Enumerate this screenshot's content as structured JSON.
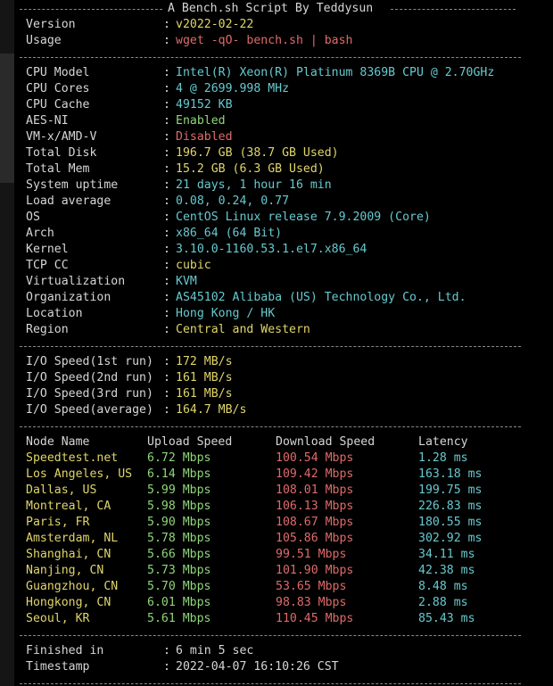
{
  "title": "A Bench.sh Script By Teddysun",
  "header": [
    {
      "label": "Version",
      "value": "v2022-02-22",
      "color": "#e0d56a"
    },
    {
      "label": "Usage",
      "value": "wget -qO- bench.sh | bash",
      "color": "#e06a6a"
    }
  ],
  "system": [
    {
      "label": "CPU Model",
      "value": "Intel(R) Xeon(R) Platinum 8369B CPU @ 2.70GHz",
      "color": "#66c9cf"
    },
    {
      "label": "CPU Cores",
      "value": "4 @ 2699.998 MHz",
      "color": "#66c9cf"
    },
    {
      "label": "CPU Cache",
      "value": "49152 KB",
      "color": "#66c9cf"
    },
    {
      "label": "AES-NI",
      "value": "Enabled",
      "color": "#8fd67a"
    },
    {
      "label": "VM-x/AMD-V",
      "value": "Disabled",
      "color": "#e06a6a"
    },
    {
      "label": "Total Disk",
      "value": "196.7 GB (38.7 GB Used)",
      "color": "#e0d56a"
    },
    {
      "label": "Total Mem",
      "value": "15.2 GB (6.3 GB Used)",
      "color": "#e0d56a"
    },
    {
      "label": "System uptime",
      "value": "21 days, 1 hour 16 min",
      "color": "#66c9cf"
    },
    {
      "label": "Load average",
      "value": "0.08, 0.24, 0.77",
      "color": "#66c9cf"
    },
    {
      "label": "OS",
      "value": "CentOS Linux release 7.9.2009 (Core)",
      "color": "#66c9cf"
    },
    {
      "label": "Arch",
      "value": "x86_64 (64 Bit)",
      "color": "#66c9cf"
    },
    {
      "label": "Kernel",
      "value": "3.10.0-1160.53.1.el7.x86_64",
      "color": "#66c9cf"
    },
    {
      "label": "TCP CC",
      "value": "cubic",
      "color": "#e0d56a"
    },
    {
      "label": "Virtualization",
      "value": "KVM",
      "color": "#66c9cf"
    },
    {
      "label": "Organization",
      "value": "AS45102 Alibaba (US) Technology Co., Ltd.",
      "color": "#66c9cf"
    },
    {
      "label": "Location",
      "value": "Hong Kong / HK",
      "color": "#66c9cf"
    },
    {
      "label": "Region",
      "value": "Central and Western",
      "color": "#e0d56a"
    }
  ],
  "io": [
    {
      "label": "I/O Speed(1st run)",
      "value": "172 MB/s",
      "color": "#e0d56a"
    },
    {
      "label": "I/O Speed(2nd run)",
      "value": "161 MB/s",
      "color": "#e0d56a"
    },
    {
      "label": "I/O Speed(3rd run)",
      "value": "161 MB/s",
      "color": "#e0d56a"
    },
    {
      "label": "I/O Speed(average)",
      "value": "164.7 MB/s",
      "color": "#e0d56a"
    }
  ],
  "speedtest": {
    "headers": [
      "Node Name",
      "Upload Speed",
      "Download Speed",
      "Latency"
    ],
    "rows": [
      {
        "node": "Speedtest.net",
        "up": "6.72 Mbps",
        "down": "100.54 Mbps",
        "lat": "1.28 ms"
      },
      {
        "node": "Los Angeles, US",
        "up": "6.14 Mbps",
        "down": "109.42 Mbps",
        "lat": "163.18 ms"
      },
      {
        "node": "Dallas, US",
        "up": "5.99 Mbps",
        "down": "108.01 Mbps",
        "lat": "199.75 ms"
      },
      {
        "node": "Montreal, CA",
        "up": "5.98 Mbps",
        "down": "106.13 Mbps",
        "lat": "226.83 ms"
      },
      {
        "node": "Paris, FR",
        "up": "5.90 Mbps",
        "down": "108.67 Mbps",
        "lat": "180.55 ms"
      },
      {
        "node": "Amsterdam, NL",
        "up": "5.78 Mbps",
        "down": "105.86 Mbps",
        "lat": "302.92 ms"
      },
      {
        "node": "Shanghai, CN",
        "up": "5.66 Mbps",
        "down": "99.51 Mbps",
        "lat": "34.11 ms"
      },
      {
        "node": "Nanjing, CN",
        "up": "5.73 Mbps",
        "down": "101.90 Mbps",
        "lat": "42.38 ms"
      },
      {
        "node": "Guangzhou, CN",
        "up": "5.70 Mbps",
        "down": "53.65 Mbps",
        "lat": "8.48 ms"
      },
      {
        "node": "Hongkong, CN",
        "up": "6.01 Mbps",
        "down": "98.83 Mbps",
        "lat": "2.88 ms"
      },
      {
        "node": "Seoul, KR",
        "up": "5.61 Mbps",
        "down": "110.45 Mbps",
        "lat": "85.43 ms"
      }
    ],
    "colors": {
      "node": "#e0d56a",
      "up": "#8fd67a",
      "down": "#e06a6a",
      "lat": "#66c9cf"
    }
  },
  "footer": [
    {
      "label": "Finished in",
      "value": "6 min 5 sec"
    },
    {
      "label": "Timestamp",
      "value": "2022-04-07 16:10:26 CST"
    }
  ]
}
